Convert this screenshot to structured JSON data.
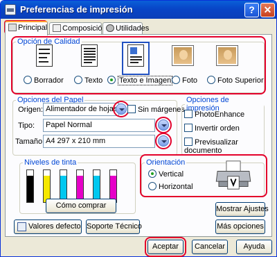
{
  "window": {
    "title": "Preferencias de impresión",
    "help_glyph": "?",
    "close_glyph": "✕"
  },
  "tabs": [
    {
      "label": "Principal",
      "active": true
    },
    {
      "label": "Composición",
      "active": false
    },
    {
      "label": "Utilidades",
      "active": false
    }
  ],
  "quality": {
    "legend": "Opción de Calidad",
    "options": [
      {
        "label": "Borrador",
        "selected": false
      },
      {
        "label": "Texto",
        "selected": false
      },
      {
        "label": "Texto e Imagen",
        "selected": true
      },
      {
        "label": "Foto",
        "selected": false
      },
      {
        "label": "Foto Superior",
        "selected": false
      }
    ]
  },
  "paper": {
    "legend": "Opciones del Papel",
    "origin_label": "Origen:",
    "origin_value": "Alimentador de hojas",
    "borderless_label": "Sin márgenes",
    "type_label": "Tipo:",
    "type_value": "Papel Normal",
    "size_label": "Tamaño:",
    "size_value": "A4 297 x 210 mm"
  },
  "print_options": {
    "legend": "Opciones de impresión",
    "items": [
      {
        "label": "PhotoEnhance",
        "checked": false
      },
      {
        "label": "Invertir orden",
        "checked": false
      },
      {
        "label": "Previsualizar documento",
        "checked": false
      }
    ]
  },
  "ink": {
    "legend": "Niveles de tinta",
    "colors": [
      "#000000",
      "#f5e800",
      "#00c8f0",
      "#e600c8",
      "#00c8f0",
      "#e600c8"
    ],
    "how_to_buy": "Cómo comprar"
  },
  "orientation": {
    "legend": "Orientación",
    "options": [
      {
        "label": "Vertical",
        "selected": true
      },
      {
        "label": "Horizontal",
        "selected": false
      }
    ]
  },
  "buttons": {
    "show_settings": "Mostrar Ajustes",
    "default_values": "Valores defecto",
    "tech_support": "Soporte Técnico",
    "more_options": "Más opciones",
    "accept": "Aceptar",
    "cancel": "Cancelar",
    "help": "Ayuda"
  },
  "accent_color": "#e3002a"
}
